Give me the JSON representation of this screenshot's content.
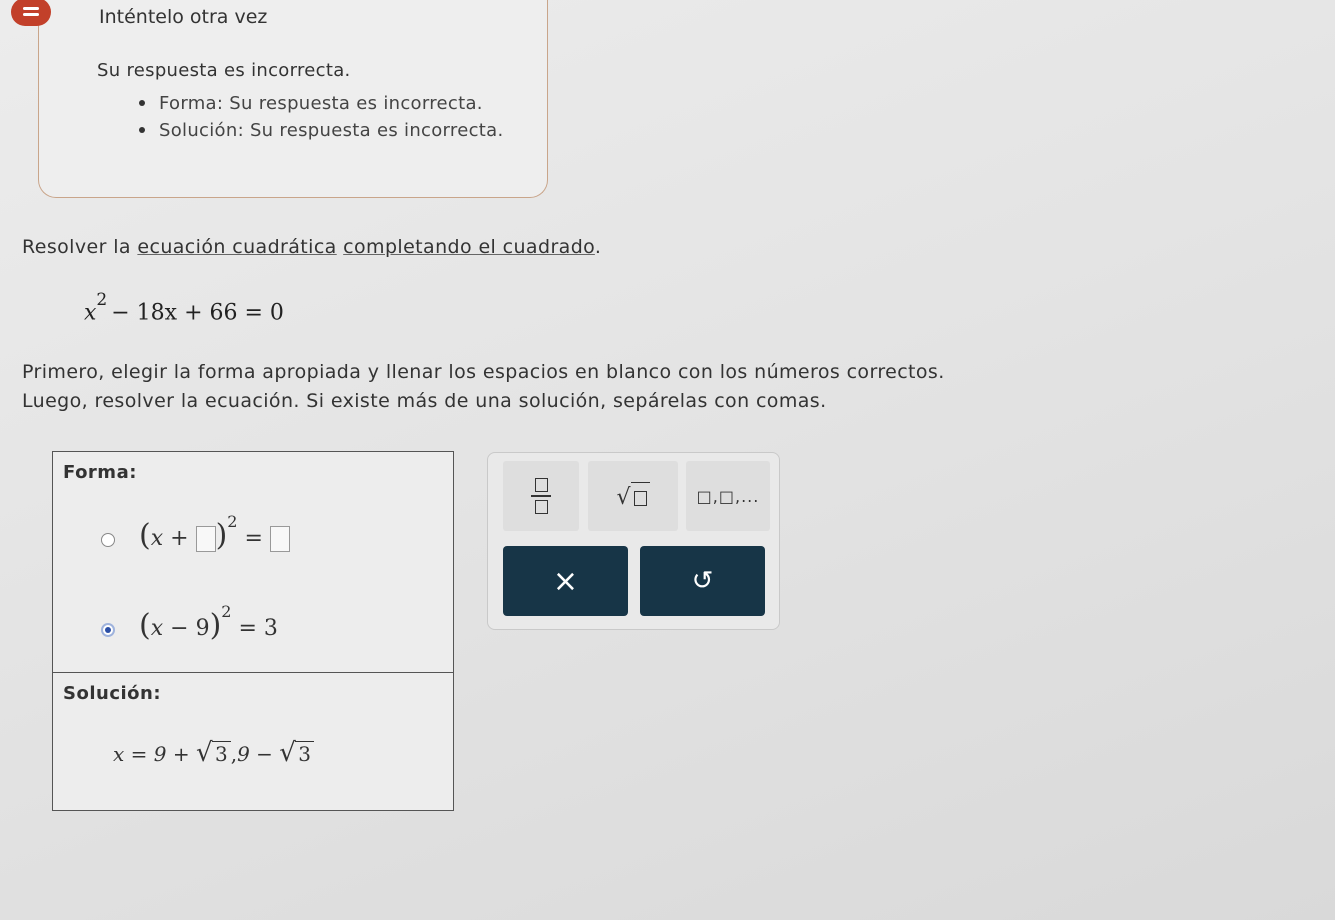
{
  "feedback": {
    "title": "Inténtelo otra vez",
    "message": "Su respuesta es incorrecta.",
    "items": [
      "Forma: Su respuesta es incorrecta.",
      "Solución: Su respuesta es incorrecta."
    ],
    "icon": "feedback-speech-icon",
    "accent": "#c2402a"
  },
  "problem": {
    "prefix": "Resolver la ",
    "link1": "ecuación cuadrática",
    "middle": " ",
    "link2": "completando el cuadrado",
    "suffix": ".",
    "equation": {
      "base": "x",
      "exp": "2",
      "rest": "− 18x + 66 = 0"
    },
    "instruction_line1": "Primero, elegir la forma apropiada y llenar los espacios en blanco con los números correctos.",
    "instruction_line2": "Luego, resolver la ecuación. Si existe más de una solución, sepárelas con comas."
  },
  "answer": {
    "form_label": "Forma:",
    "option1": {
      "open": "(",
      "x": "x",
      "op": "+",
      "close": ")",
      "exp": "2",
      "eq": "="
    },
    "option2": {
      "open": "(",
      "x": "x",
      "op": "−",
      "num": "9",
      "close": ")",
      "exp": "2",
      "eq": "=",
      "rhs": "3",
      "selected": true
    },
    "solution_label": "Solución:",
    "solution": {
      "lhs": "x",
      "eq": "=",
      "a": "9",
      "plus": "+",
      "root1": "3",
      "comma": ",",
      "b": "9",
      "minus": "−",
      "root2": "3"
    }
  },
  "toolbar": {
    "fraction": "fraction-icon",
    "sqrt": "sqrt-icon",
    "list": "□,□,...",
    "clear": "×",
    "undo": "↺",
    "button_color": "#173547"
  }
}
